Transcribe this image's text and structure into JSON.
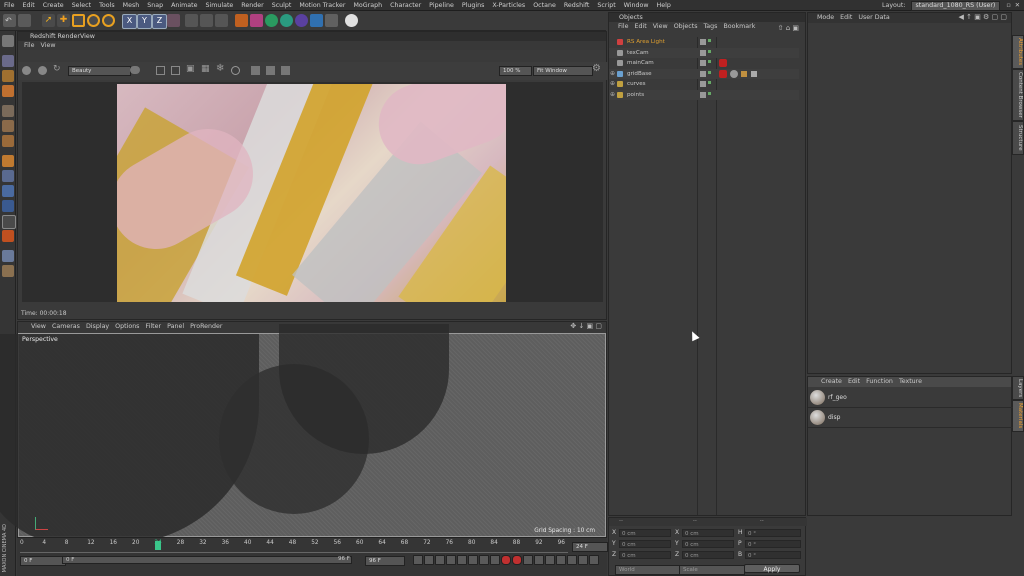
{
  "menu": [
    "File",
    "Edit",
    "Create",
    "Select",
    "Tools",
    "Mesh",
    "Snap",
    "Animate",
    "Simulate",
    "Render",
    "Sculpt",
    "Motion Tracker",
    "MoGraph",
    "Character",
    "Pipeline",
    "Plugins",
    "X-Particles",
    "Octane",
    "Redshift",
    "Script",
    "Window",
    "Help"
  ],
  "layout": {
    "label": "Layout:",
    "value": "standard_1080_RS (User)"
  },
  "toolbar": {
    "x": "X",
    "y": "Y",
    "z": "Z"
  },
  "renderview": {
    "title": "Redshift RenderView",
    "menu": [
      "File",
      "View"
    ],
    "beauty": "Beauty",
    "zoom": "100 %",
    "fit": "Fit Window",
    "time": "Time: 00:00:18"
  },
  "viewport": {
    "menu": [
      "View",
      "Cameras",
      "Display",
      "Options",
      "Filter",
      "Panel",
      "ProRender"
    ],
    "label": "Perspective",
    "grid": "Grid Spacing : 10 cm"
  },
  "objects": {
    "title": "Objects",
    "menu": [
      "File",
      "Edit",
      "View",
      "Objects",
      "Tags",
      "Bookmark"
    ],
    "items": [
      {
        "name": "RS Area Light",
        "color": "#e0a030"
      },
      {
        "name": "texCam",
        "color": "#c8c8c8"
      },
      {
        "name": "mainCam",
        "color": "#c8c8c8"
      },
      {
        "name": "gridBase",
        "color": "#c8c8c8"
      },
      {
        "name": "curves",
        "color": "#c8c8c8"
      },
      {
        "name": "points",
        "color": "#c8c8c8"
      }
    ]
  },
  "attributes": {
    "menu": [
      "Mode",
      "Edit",
      "User Data"
    ]
  },
  "sidetabs": {
    "top": [
      "Attributes",
      "Content Browser",
      "Structure"
    ],
    "bottom": [
      "Layers",
      "Materials"
    ]
  },
  "materials": {
    "menu": [
      "Create",
      "Edit",
      "Function",
      "Texture"
    ],
    "items": [
      "rf_geo",
      "disp"
    ]
  },
  "coords": {
    "labels": [
      "X",
      "Y",
      "Z"
    ],
    "pos": [
      "0 cm",
      "0 cm",
      "0 cm"
    ],
    "size": [
      "0 cm",
      "0 cm",
      "0 cm"
    ],
    "rot_labels": [
      "H",
      "P",
      "B"
    ],
    "rot": [
      "0 °",
      "0 °",
      "0 °"
    ],
    "mode1": "World",
    "mode2": "Scale",
    "apply": "Apply"
  },
  "timeline": {
    "ticks": [
      "0",
      "4",
      "8",
      "12",
      "16",
      "20",
      "24",
      "28",
      "32",
      "36",
      "40",
      "44",
      "48",
      "52",
      "56",
      "60",
      "64",
      "68",
      "72",
      "76",
      "80",
      "84",
      "88",
      "92",
      "96"
    ],
    "current": "24",
    "current_frame_label": "24 F",
    "start": "0 F",
    "field2": "0 F",
    "end1": "96 F",
    "end2": "96 F"
  },
  "brand": "MAXON CINEMA 4D"
}
